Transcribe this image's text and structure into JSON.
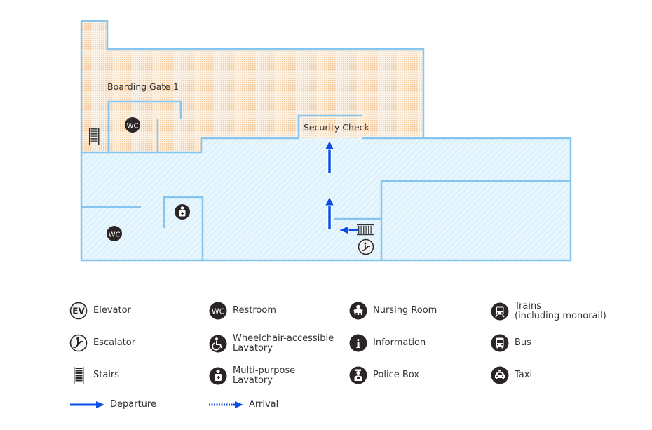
{
  "map": {
    "areas": {
      "departure_area_label": "Boarding Gate 1",
      "security_label": "Security Check"
    },
    "colors": {
      "wall": "#86c5ee",
      "restricted_fill": "#f6e3cc",
      "restricted_dot": "#f0c89a",
      "public_fill": "#e6f5fd",
      "public_hatch": "#cfe9f8",
      "route_arrow": "#0a4ee8",
      "icon_dark": "#2b2526"
    },
    "facilities": [
      {
        "name": "stairs",
        "icon": "stairs-icon"
      },
      {
        "name": "restroom-upper",
        "icon": "wc-icon",
        "text": "WC"
      },
      {
        "name": "restroom-lower",
        "icon": "wc-icon",
        "text": "WC"
      },
      {
        "name": "multi-purpose-lavatory",
        "icon": "multipurpose-lavatory-icon"
      },
      {
        "name": "escalator",
        "icon": "escalator-icon"
      }
    ]
  },
  "legend": {
    "items": [
      {
        "label": "Elevator",
        "icon": "elevator-icon",
        "glyph": "EV"
      },
      {
        "label": "Restroom",
        "icon": "wc-icon",
        "glyph": "WC"
      },
      {
        "label": "Nursing Room",
        "icon": "nursing-room-icon"
      },
      {
        "label": "Trains\n (including monorail)",
        "icon": "train-icon"
      },
      {
        "label": "Escalator",
        "icon": "escalator-icon"
      },
      {
        "label": "Wheelchair-accessible\nLavatory",
        "icon": "wheelchair-icon"
      },
      {
        "label": "Information",
        "icon": "information-icon",
        "glyph": "i"
      },
      {
        "label": "Bus",
        "icon": "bus-icon"
      },
      {
        "label": "Stairs",
        "icon": "stairs-icon"
      },
      {
        "label": "Multi-purpose\nLavatory",
        "icon": "multipurpose-lavatory-icon"
      },
      {
        "label": "Police Box",
        "icon": "police-box-icon"
      },
      {
        "label": "Taxi",
        "icon": "taxi-icon"
      }
    ],
    "routes": [
      {
        "label": "Departure",
        "style": "solid"
      },
      {
        "label": "Arrival",
        "style": "dotted"
      }
    ]
  }
}
